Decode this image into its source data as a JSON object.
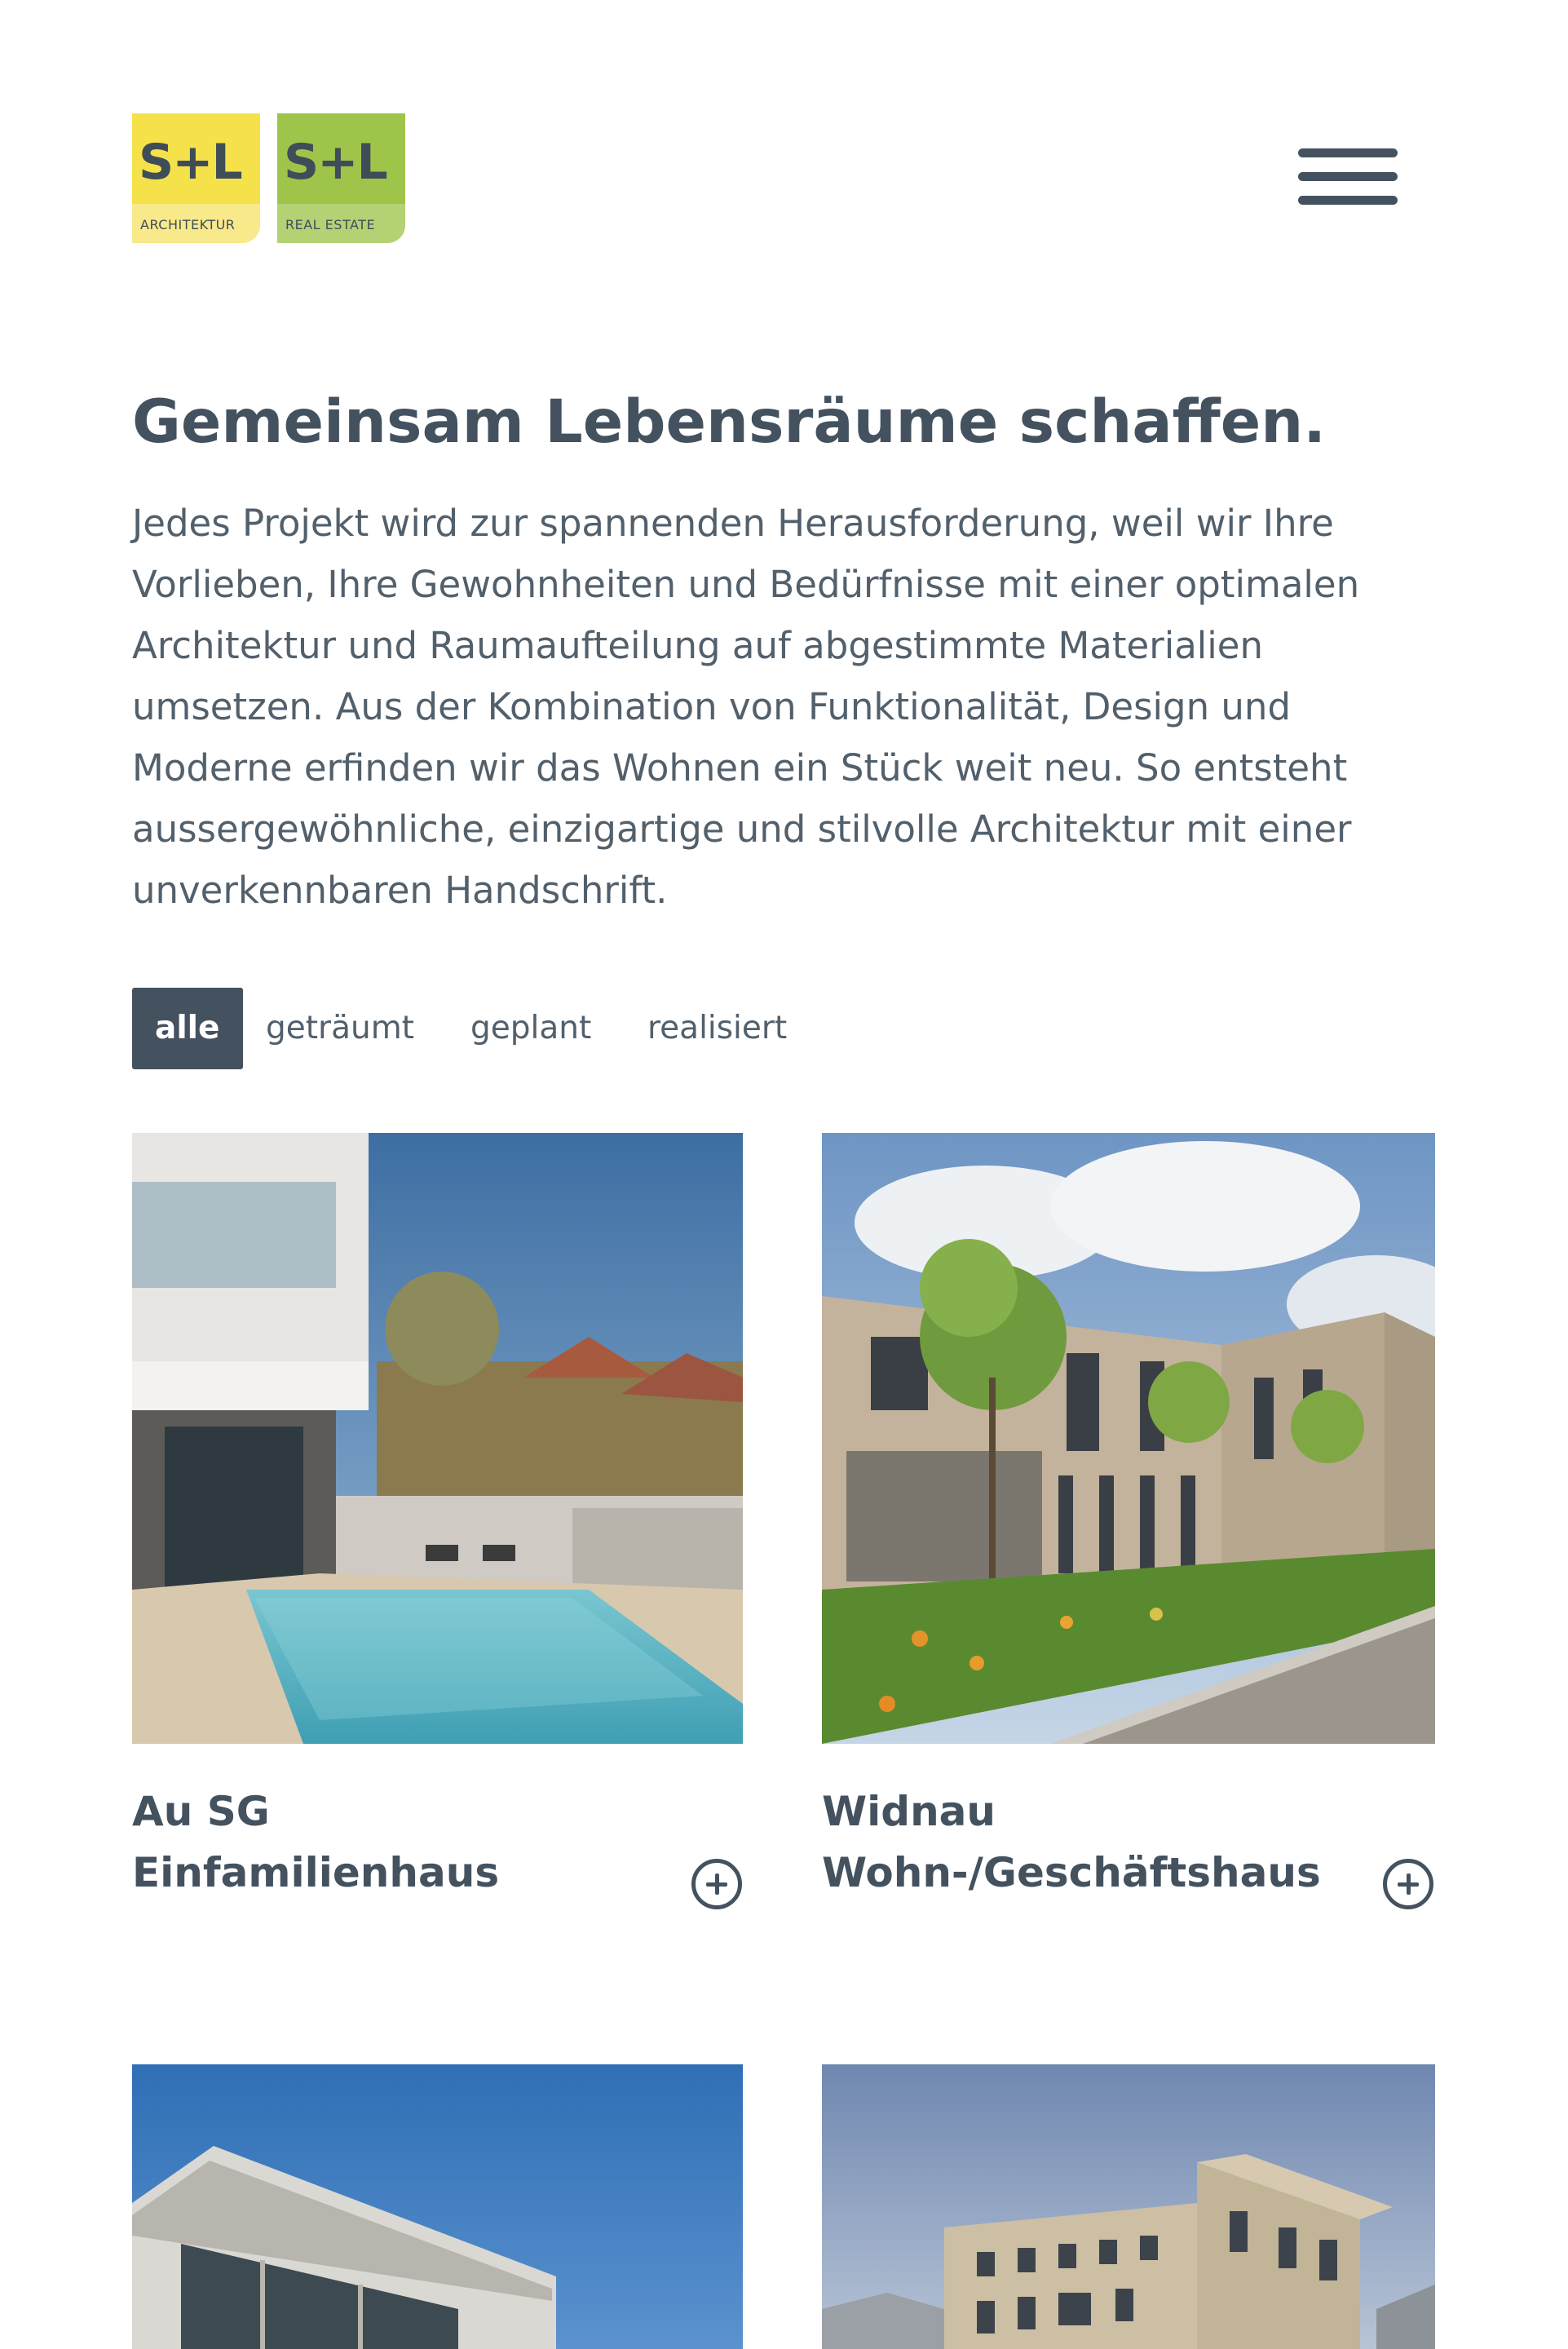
{
  "header": {
    "logo_architektur": {
      "mark": "S+L",
      "sub": "ARCHITEKTUR",
      "color": "#f5e14a"
    },
    "logo_real_estate": {
      "mark": "S+L",
      "sub": "REAL ESTATE",
      "color": "#9fc44a"
    },
    "menu_icon": "hamburger-menu-icon"
  },
  "intro": {
    "headline": "Gemeinsam Lebensräume schaffen.",
    "text": "Jedes Projekt wird zur spannenden Herausforderung, weil wir Ihre Vorlieben, Ihre Gewohnheiten und Bedürfnisse mit einer optimalen Architektur und Raumaufteilung auf abgestimmte Materialien umsetzen. Aus der Kombination von Funktionalität, Design und Moderne erfinden wir das Wohnen ein Stück weit neu. So entsteht aussergewöhnliche, einzigartige und stilvolle Architektur mit einer unverkennbaren Handschrift."
  },
  "filters": {
    "all": "alle",
    "dreamed": "geträumt",
    "planned": "geplant",
    "realized": "realisiert",
    "active": "alle"
  },
  "projects": [
    {
      "location": "Au SG",
      "type": "Einfamilienhaus",
      "image": "photo of house with swimming pool",
      "icon": "plus-circle-icon"
    },
    {
      "location": "Widnau",
      "type": "Wohn-/Geschäftshaus",
      "image": "photo of residential and commercial building with garden",
      "icon": "plus-circle-icon"
    },
    {
      "image": "photo of modern white house against blue sky"
    },
    {
      "image": "photo of multi-storey apartment building"
    }
  ],
  "colors": {
    "text": "#44525f",
    "active_filter_bg": "#44525f",
    "logo_yellow": "#f5e14a",
    "logo_green": "#9fc44a"
  }
}
